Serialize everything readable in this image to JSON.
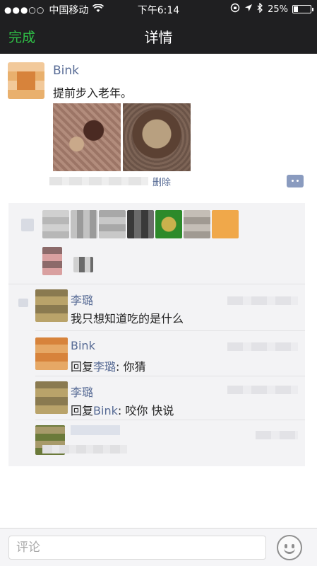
{
  "status_bar": {
    "signal": "●●●○○",
    "carrier": "中国移动",
    "time": "下午6:14",
    "battery": "25%",
    "battery_level": 0.25
  },
  "nav": {
    "done_label": "完成",
    "title": "详情"
  },
  "post": {
    "author": "Bink",
    "text": "提前步入老年。",
    "delete_label": "删除"
  },
  "comments": [
    {
      "name": "李璐",
      "text": "我只想知道吃的是什么"
    },
    {
      "name": "Bink",
      "reply_prefix": "回复",
      "reply_to": "李璐",
      "text": ": 你猜"
    },
    {
      "name": "李璐",
      "reply_prefix": "回复",
      "reply_to": "Bink",
      "text": ": 咬你  快说"
    }
  ],
  "input": {
    "placeholder": "评论"
  },
  "colors": {
    "accent_green": "#2fc147",
    "link_blue": "#576b95",
    "nav_bg": "#1f1f21"
  }
}
